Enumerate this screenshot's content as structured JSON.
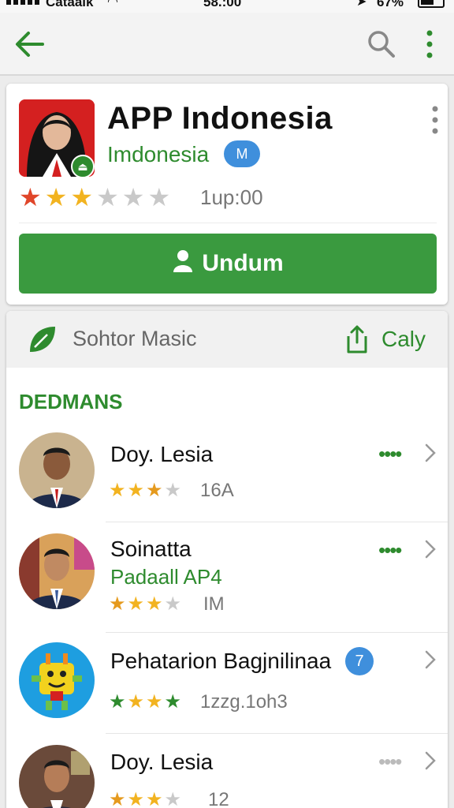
{
  "status_bar": {
    "carrier": "Cataalk",
    "time": "58.:00",
    "battery": "67%"
  },
  "top_bar": {
    "back_icon": "arrow-left-icon",
    "search_icon": "search-icon",
    "menu_icon": "more-vertical-icon"
  },
  "app": {
    "title": "APP Indonesia",
    "developer": "Imdonesia",
    "verified_label": "M",
    "rating_text": "1up:00",
    "stars": {
      "filled": 3,
      "total": 6
    },
    "install_label": "Undum",
    "accent_color": "#3a9a3f"
  },
  "section": {
    "title": "Sohtor Masic",
    "share_label": "Caly",
    "heading": "DEDMANS"
  },
  "items": [
    {
      "name": "Doy. Lesia",
      "subtitle": "",
      "count": "16A",
      "stars_filled": 3,
      "stars_total": 4,
      "dots": "••••",
      "badge": ""
    },
    {
      "name": "Soinatta",
      "subtitle": "Padaall AP4",
      "count": "IM",
      "stars_filled": 3,
      "stars_total": 4,
      "dots": "••••",
      "badge": ""
    },
    {
      "name": "Pehatarion Bagjnilinaa",
      "subtitle": "",
      "count": "1zzg.1oh3",
      "stars_filled": 4,
      "stars_total": 4,
      "dots": "",
      "badge": "7"
    },
    {
      "name": "Doy. Lesia",
      "subtitle": "",
      "count": "12",
      "stars_filled": 3,
      "stars_total": 4,
      "dots": "••••",
      "badge": ""
    }
  ]
}
